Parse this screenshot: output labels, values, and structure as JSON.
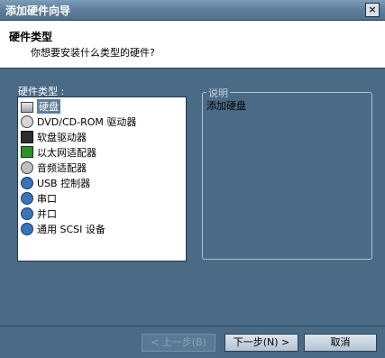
{
  "window": {
    "title": "添加硬件向导"
  },
  "header": {
    "title": "硬件类型",
    "subtitle": "你想要安装什么类型的硬件?"
  },
  "list": {
    "label": "硬件类型 :",
    "items": [
      {
        "label": "硬盘",
        "icon": "hard-disk-icon"
      },
      {
        "label": "DVD/CD-ROM 驱动器",
        "icon": "cd-drive-icon"
      },
      {
        "label": "软盘驱动器",
        "icon": "floppy-drive-icon"
      },
      {
        "label": "以太网适配器",
        "icon": "ethernet-adapter-icon"
      },
      {
        "label": "音频适配器",
        "icon": "audio-adapter-icon"
      },
      {
        "label": "USB 控制器",
        "icon": "usb-icon"
      },
      {
        "label": "串口",
        "icon": "serial-port-icon"
      },
      {
        "label": "并口",
        "icon": "parallel-port-icon"
      },
      {
        "label": "通用 SCSI 设备",
        "icon": "scsi-icon"
      }
    ],
    "selected_index": 0
  },
  "description": {
    "legend": "说明",
    "text": "添加硬盘"
  },
  "buttons": {
    "prev": "< 上一步(B)",
    "next": "下一步(N) >",
    "cancel": "取消"
  }
}
